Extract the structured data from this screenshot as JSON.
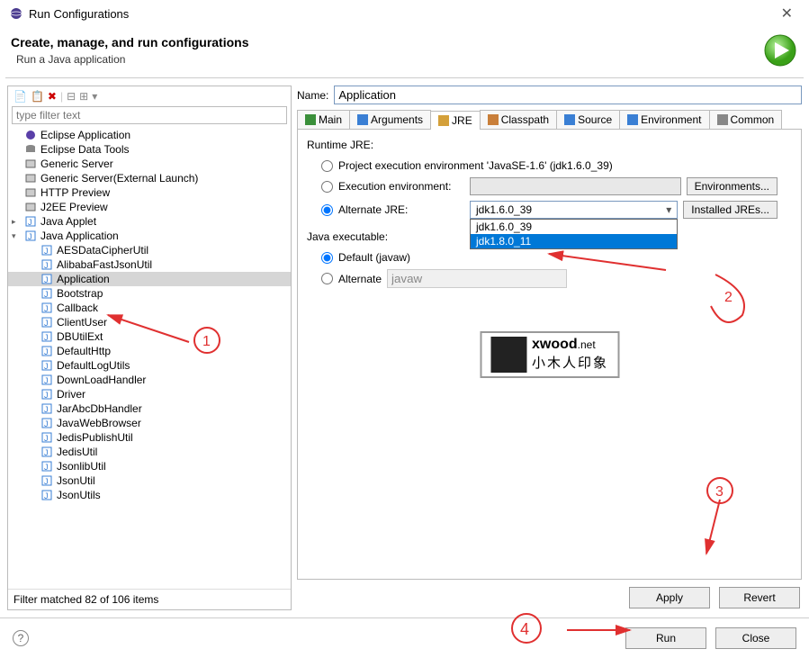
{
  "window": {
    "title": "Run Configurations"
  },
  "header": {
    "title": "Create, manage, and run configurations",
    "subtitle": "Run a Java application"
  },
  "left": {
    "filter_placeholder": "type filter text",
    "tree": [
      {
        "label": "Eclipse Application",
        "kind": "eclipse"
      },
      {
        "label": "Eclipse Data Tools",
        "kind": "db"
      },
      {
        "label": "Generic Server",
        "kind": "server"
      },
      {
        "label": "Generic Server(External Launch)",
        "kind": "server"
      },
      {
        "label": "HTTP Preview",
        "kind": "server"
      },
      {
        "label": "J2EE Preview",
        "kind": "server"
      },
      {
        "label": "Java Applet",
        "kind": "java",
        "expandable": true
      },
      {
        "label": "Java Application",
        "kind": "java",
        "expandable": true,
        "expanded": true,
        "children": [
          {
            "label": "AESDataCipherUtil"
          },
          {
            "label": "AlibabaFastJsonUtil"
          },
          {
            "label": "Application",
            "selected": true
          },
          {
            "label": "Bootstrap"
          },
          {
            "label": "Callback"
          },
          {
            "label": "ClientUser"
          },
          {
            "label": "DBUtilExt"
          },
          {
            "label": "DefaultHttp"
          },
          {
            "label": "DefaultLogUtils"
          },
          {
            "label": "DownLoadHandler"
          },
          {
            "label": "Driver"
          },
          {
            "label": "JarAbcDbHandler"
          },
          {
            "label": "JavaWebBrowser"
          },
          {
            "label": "JedisPublishUtil"
          },
          {
            "label": "JedisUtil"
          },
          {
            "label": "JsonlibUtil"
          },
          {
            "label": "JsonUtil"
          },
          {
            "label": "JsonUtils"
          }
        ]
      }
    ],
    "status": "Filter matched 82 of 106 items"
  },
  "right": {
    "name_label": "Name:",
    "name_value": "Application",
    "tabs": [
      "Main",
      "Arguments",
      "JRE",
      "Classpath",
      "Source",
      "Environment",
      "Common"
    ],
    "active_tab": "JRE",
    "runtime_jre_label": "Runtime JRE:",
    "project_exec_label": "Project execution environment 'JavaSE-1.6' (jdk1.6.0_39)",
    "exec_env_label": "Execution environment:",
    "environments_btn": "Environments...",
    "alternate_jre_label": "Alternate JRE:",
    "alternate_jre_selected": "jdk1.6.0_39",
    "alternate_jre_options": [
      "jdk1.6.0_39",
      "jdk1.8.0_11"
    ],
    "installed_jres_btn": "Installed JREs...",
    "java_exec_label": "Java executable:",
    "default_exec_label": "Default (javaw)",
    "alternate_exec_label": "Alternate",
    "alternate_exec_value": "javaw",
    "apply_btn": "Apply",
    "revert_btn": "Revert"
  },
  "footer": {
    "run_btn": "Run",
    "close_btn": "Close"
  },
  "watermark": {
    "text1": "xwood",
    "text2": ".net",
    "text3": "小木人印象"
  }
}
